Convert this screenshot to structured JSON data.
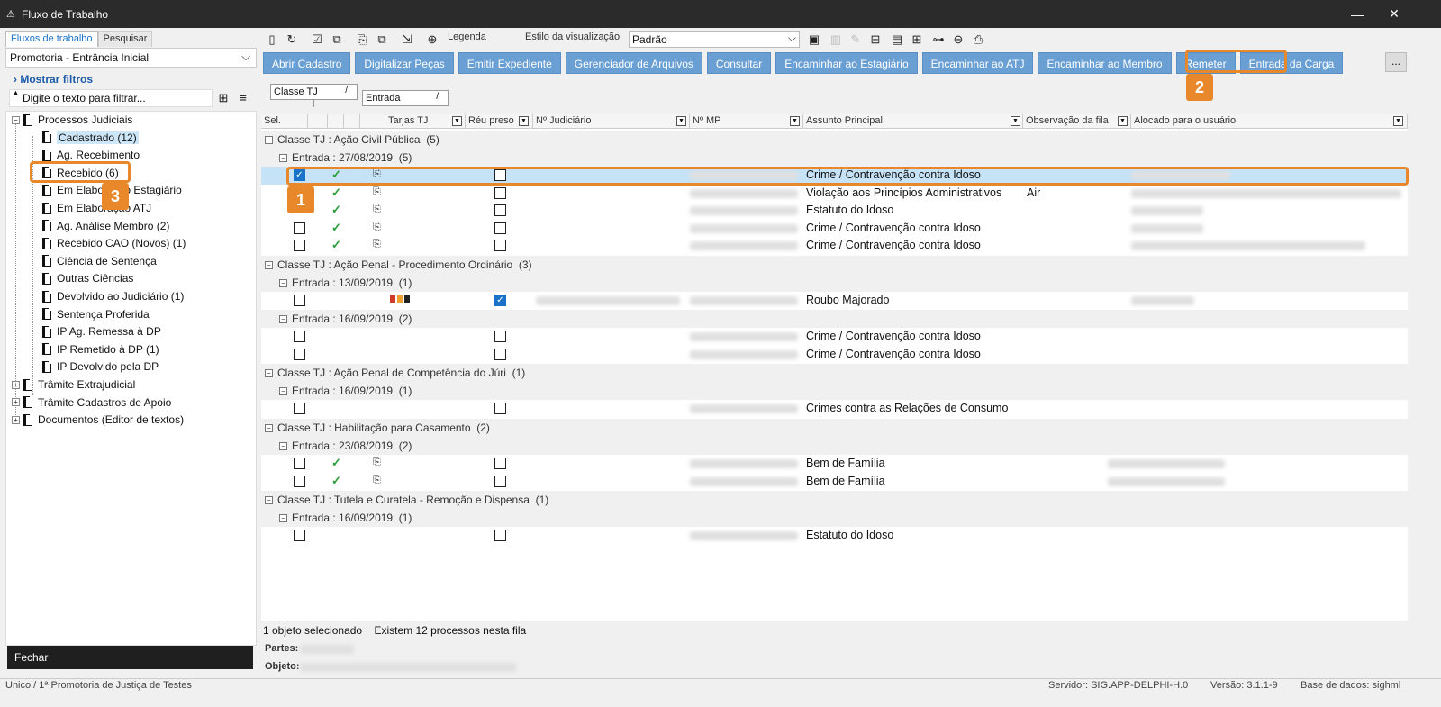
{
  "window": {
    "title": "Fluxo de Trabalho",
    "minimize": "—",
    "close": "✕"
  },
  "left": {
    "tabs": [
      "Fluxos de trabalho",
      "Pesquisar"
    ],
    "flow_combo": "Promotoria - Entrância Inicial",
    "show_filters": "Mostrar filtros",
    "filter_placeholder": "Digite o texto para filtrar...",
    "tree": {
      "root": "Processos Judiciais",
      "items": [
        "Cadastrado (12)",
        "Ag. Recebimento",
        "Recebido (6)",
        "Em Elaboração Estagiário",
        "Em Elaboração ATJ",
        "Ag. Análise Membro (2)",
        "Recebido CAO (Novos) (1)",
        "Ciência de Sentença",
        "Outras Ciências",
        "Devolvido ao Judiciário (1)",
        "Sentença Proferida",
        "IP Ag. Remessa à DP",
        "IP Remetido à DP (1)",
        "IP Devolvido pela DP"
      ],
      "others": [
        "Trâmite Extrajudicial",
        "Trâmite Cadastros de Apoio",
        "Documentos (Editor de textos)"
      ]
    },
    "close_button": "Fechar"
  },
  "toolbar": {
    "legend": "Legenda",
    "view_style_label": "Estilo da visualização",
    "view_style_value": "Padrão"
  },
  "actions": [
    "Abrir Cadastro",
    "Digitalizar Peças",
    "Emitir Expediente",
    "Gerenciador de Arquivos",
    "Consultar",
    "Encaminhar ao Estagiário",
    "Encaminhar ao ATJ",
    "Encaminhar ao Membro",
    "Remeter",
    "Entrada da Carga"
  ],
  "more_button": "...",
  "grouping": {
    "box1": "Classe TJ",
    "box2": "Entrada"
  },
  "columns": [
    "Sel.",
    "Tarjas TJ",
    "Réu preso",
    "Nº Judiciário",
    "Nº MP",
    "Assunto Principal",
    "Observação da fila",
    "Alocado para o usuário"
  ],
  "groups": [
    {
      "title": "Classe TJ : Ação Civil Pública",
      "count": "(5)",
      "entries": [
        {
          "title": "Entrada : 27/08/2019",
          "count": "(5)",
          "rows": [
            {
              "subject": "Crime / Contravenção contra Idoso",
              "obs": ""
            },
            {
              "subject": "Violação aos Princípios Administrativos",
              "obs": "Air"
            },
            {
              "subject": "Estatuto do Idoso",
              "obs": ""
            },
            {
              "subject": "Crime / Contravenção contra Idoso",
              "obs": ""
            },
            {
              "subject": "Crime / Contravenção contra Idoso",
              "obs": ""
            }
          ]
        }
      ]
    },
    {
      "title": "Classe TJ : Ação Penal - Procedimento Ordinário",
      "count": "(3)",
      "entries": [
        {
          "title": "Entrada : 13/09/2019",
          "count": "(1)",
          "rows": [
            {
              "subject": "Roubo Majorado",
              "obs": ""
            }
          ]
        },
        {
          "title": "Entrada : 16/09/2019",
          "count": "(2)",
          "rows": [
            {
              "subject": "Crime / Contravenção contra Idoso",
              "obs": ""
            },
            {
              "subject": "Crime / Contravenção contra Idoso",
              "obs": ""
            }
          ]
        }
      ]
    },
    {
      "title": "Classe TJ : Ação Penal de Competência do Júri",
      "count": "(1)",
      "entries": [
        {
          "title": "Entrada : 16/09/2019",
          "count": "(1)",
          "rows": [
            {
              "subject": "Crimes contra as Relações de Consumo",
              "obs": ""
            }
          ]
        }
      ]
    },
    {
      "title": "Classe TJ : Habilitação para Casamento",
      "count": "(2)",
      "entries": [
        {
          "title": "Entrada : 23/08/2019",
          "count": "(2)",
          "rows": [
            {
              "subject": "Bem de Família",
              "obs": ""
            },
            {
              "subject": "Bem de Família",
              "obs": ""
            }
          ]
        }
      ]
    },
    {
      "title": "Classe TJ : Tutela e Curatela - Remoção e Dispensa",
      "count": "(1)",
      "entries": [
        {
          "title": "Entrada : 16/09/2019",
          "count": "(1)",
          "rows": [
            {
              "subject": "Estatuto do Idoso",
              "obs": ""
            }
          ]
        }
      ]
    }
  ],
  "status": {
    "selected": "1 objeto selecionado",
    "total": "Existem 12 processos nesta fila",
    "parts_label": "Partes:",
    "object_label": "Objeto:"
  },
  "footer": {
    "unit": "Unico / 1ª Promotoria de Justiça de Testes",
    "server": "Servidor: SIG.APP-DELPHI-H.0",
    "version": "Versão: 3.1.1-9",
    "database": "Base de dados: sighml"
  },
  "callouts": [
    "1",
    "2",
    "3"
  ],
  "colors": {
    "accent": "#e8882a",
    "action_button": "#6a9fd4",
    "selection": "#c6e2f7"
  }
}
